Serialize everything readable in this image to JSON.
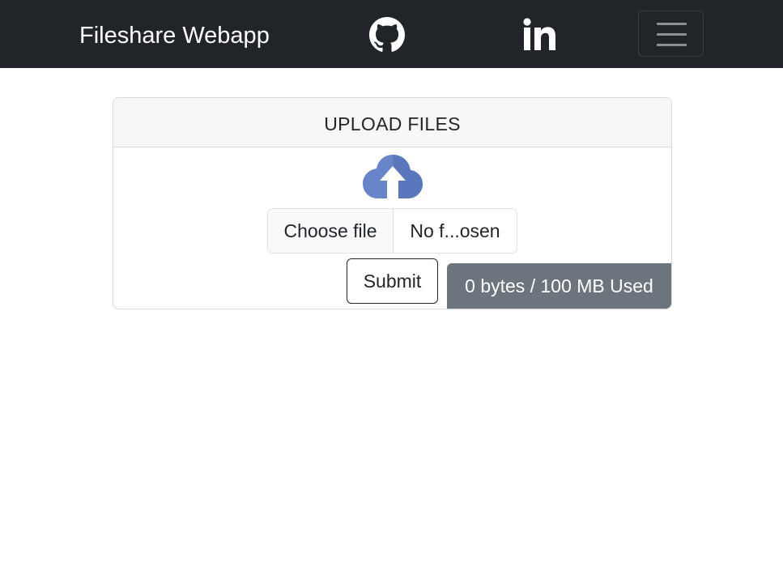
{
  "navbar": {
    "brand": "Fileshare Webapp",
    "links": [
      {
        "icon": "github-icon"
      },
      {
        "icon": "linkedin-icon"
      }
    ],
    "toggler_icon": "hamburger-menu-icon",
    "background": "#212529"
  },
  "card": {
    "header_title": "UPLOAD FILES",
    "upload_icon": "cloud-upload-icon",
    "upload_icon_color": "#5f7ec4",
    "file_input": {
      "button_label": "Choose file",
      "file_name": "No f...osen"
    },
    "submit_label": "Submit",
    "usage_text": "0 bytes / 100 MB Used",
    "usage_badge_color": "#6c757d"
  }
}
